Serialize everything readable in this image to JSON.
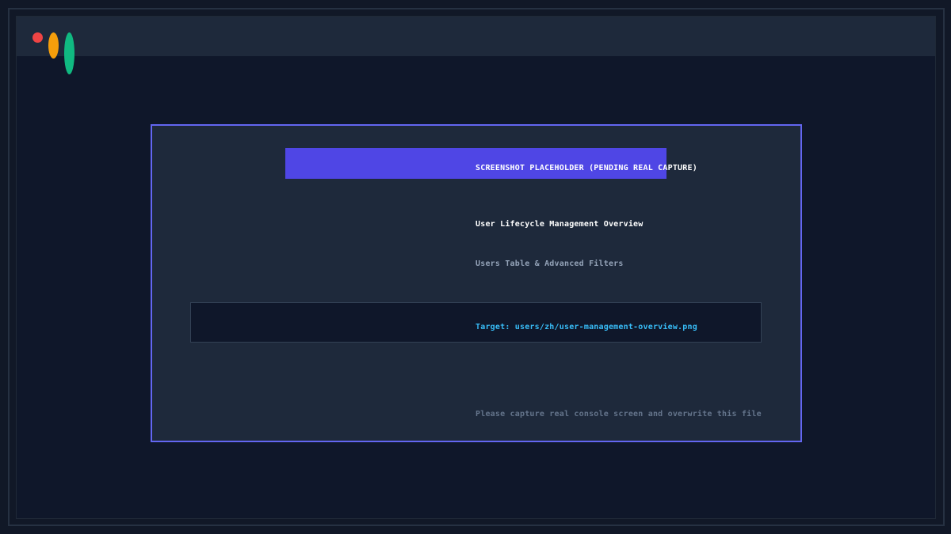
{
  "window": {
    "controls": {
      "close_color": "#ef4444",
      "minimize_color": "#f59e0b",
      "maximize_color": "#10b981"
    }
  },
  "placeholder": {
    "banner": "SCREENSHOT PLACEHOLDER (PENDING REAL CAPTURE)",
    "title": "User Lifecycle Management Overview",
    "subtitle": "Users Table & Advanced Filters",
    "target": "Target: users/zh/user-management-overview.png",
    "footer": "Please capture real console screen and overwrite this file"
  },
  "colors": {
    "accent": "#6366f1",
    "banner_bg": "#4f46e5",
    "target_text": "#38bdf8"
  }
}
